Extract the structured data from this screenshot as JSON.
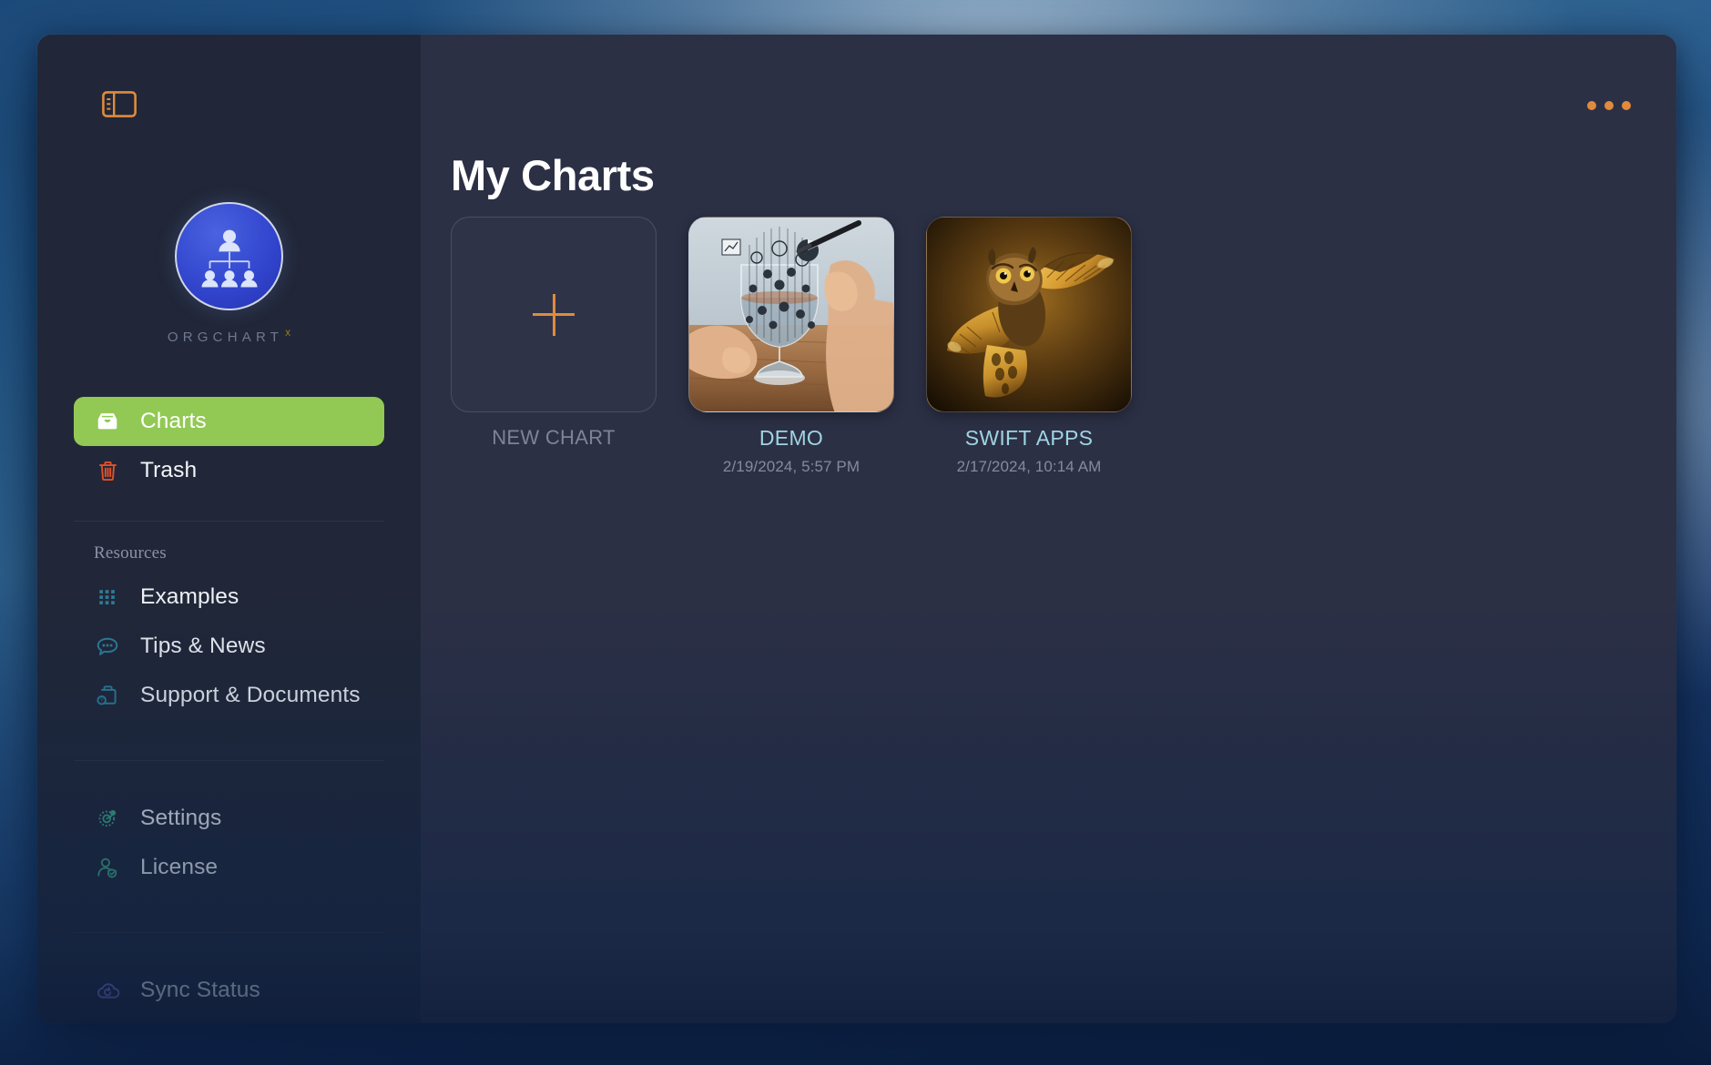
{
  "window": {
    "sidebar_toggle_icon": "sidebar-toggle-icon",
    "more_menu_icon": "ellipsis-icon"
  },
  "brand": {
    "app_icon": "orgchart-app-icon",
    "wordmark": "ORGCHART",
    "superscript": "X"
  },
  "sidebar": {
    "primary_items": [
      {
        "label": "Charts",
        "icon": "inbox-tray-icon",
        "active": true,
        "icon_color": "#ffffff"
      },
      {
        "label": "Trash",
        "icon": "trash-icon",
        "active": false,
        "icon_color": "#e0512a"
      }
    ],
    "resources_title": "Resources",
    "resource_items": [
      {
        "label": "Examples",
        "icon": "grid-dots-icon",
        "icon_color": "#2e7f99"
      },
      {
        "label": "Tips & News",
        "icon": "speech-bubble-icon",
        "icon_color": "#2e7f99"
      },
      {
        "label": "Support & Documents",
        "icon": "briefcase-question-icon",
        "icon_color": "#2e7f99"
      }
    ],
    "settings_items": [
      {
        "label": "Settings",
        "icon": "gear-icon",
        "icon_color": "#3fa98a"
      },
      {
        "label": "License",
        "icon": "person-verified-icon",
        "icon_color": "#3fa98a"
      }
    ],
    "status_items": [
      {
        "label": "Sync Status",
        "icon": "cloud-sync-icon",
        "icon_color": "#7b74d4"
      }
    ]
  },
  "main": {
    "page_title": "My Charts",
    "cards": [
      {
        "label": "NEW CHART",
        "date": "",
        "kind": "placeholder",
        "icon": "plus-icon"
      },
      {
        "label": "DEMO",
        "date": "2/19/2024, 5:57 PM",
        "kind": "image",
        "icon": "chart-glass-thumbnail"
      },
      {
        "label": "SWIFT APPS",
        "date": "2/17/2024, 10:14 AM",
        "kind": "image",
        "icon": "owl-thumbnail"
      }
    ]
  },
  "colors": {
    "accent_orange": "#e08b3c",
    "active_green": "#92c954",
    "card_title_cyan": "#9fd4e3",
    "sidebar_bg": "#212738",
    "main_bg": "#2c3045",
    "trash_red": "#e0512a",
    "resource_teal": "#2e7f99",
    "settings_green": "#3fa98a",
    "sync_purple": "#7b74d4",
    "brand_gold": "#a8901f"
  }
}
